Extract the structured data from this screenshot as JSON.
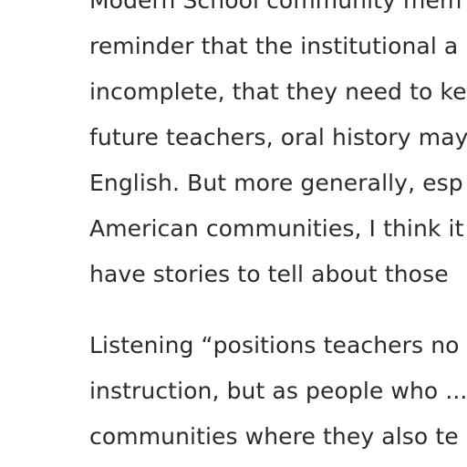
{
  "article": {
    "paragraphs": [
      {
        "lines": [
          "Modern School community mem",
          "reminder that the institutional a",
          "incomplete, that they need to ke",
          "future teachers, oral history may",
          "English. But more generally, esp",
          "American communities, I think it",
          "have stories to tell about those"
        ]
      },
      {
        "lines": [
          "Listening “positions teachers no",
          "instruction, but as people who ...",
          "communities where they also te"
        ]
      }
    ]
  }
}
